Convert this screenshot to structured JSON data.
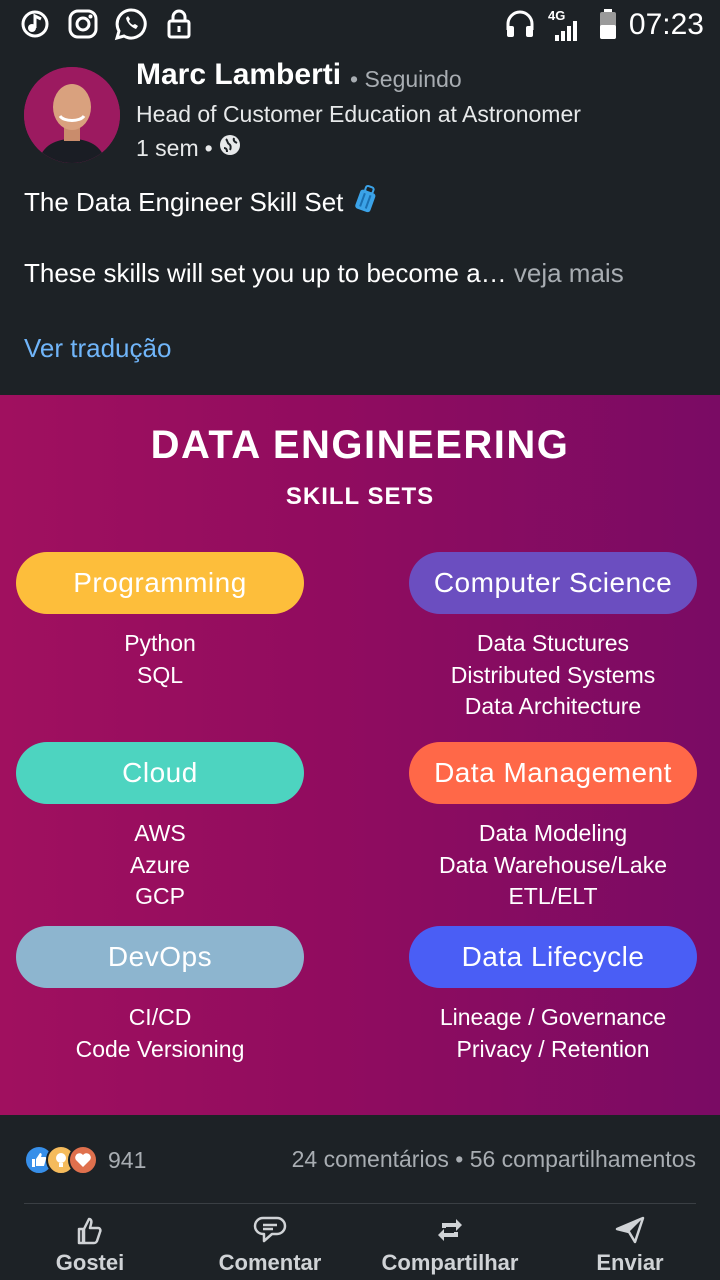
{
  "status_bar": {
    "time": "07:23",
    "network": "4G"
  },
  "post": {
    "author": {
      "name": "Marc Lamberti",
      "follow_state": "Seguindo",
      "headline": "Head of Customer Education at Astronomer",
      "time": "1 sem"
    },
    "title": "The Data Engineer Skill Set",
    "body_preview": "These skills will set you up to become a…",
    "see_more": "veja mais",
    "translate": "Ver tradução"
  },
  "infographic": {
    "title": "DATA ENGINEERING",
    "subtitle": "SKILL SETS",
    "categories": [
      {
        "label": "Programming",
        "color": "#fdbe3b",
        "items": [
          "Python",
          "SQL"
        ]
      },
      {
        "label": "Computer Science",
        "color": "#6b4ec0",
        "items": [
          "Data Stuctures",
          "Distributed Systems",
          "Data Architecture"
        ]
      },
      {
        "label": "Cloud",
        "color": "#4dd4c0",
        "items": [
          "AWS",
          "Azure",
          "GCP"
        ]
      },
      {
        "label": "Data Management",
        "color": "#ff6848",
        "items": [
          "Data Modeling",
          "Data Warehouse/Lake",
          "ETL/ELT"
        ]
      },
      {
        "label": "DevOps",
        "color": "#8db5cf",
        "items": [
          "CI/CD",
          "Code Versioning"
        ]
      },
      {
        "label": "Data Lifecycle",
        "color": "#4a5ef5",
        "items": [
          "Lineage / Governance",
          "Privacy / Retention"
        ]
      }
    ]
  },
  "social": {
    "reaction_count": "941",
    "comments": "24 comentários",
    "shares": "56 compartilhamentos",
    "separator": "•"
  },
  "actions": {
    "like": "Gostei",
    "comment": "Comentar",
    "share": "Compartilhar",
    "send": "Enviar"
  },
  "colors": {
    "background": "#1d2226",
    "link": "#70b5f9",
    "muted": "#a8adb2"
  },
  "icons": [
    "music-app-icon",
    "instagram-icon",
    "whatsapp-icon",
    "lock-icon",
    "headphones-icon",
    "signal-icon",
    "battery-icon",
    "globe-icon",
    "luggage-icon",
    "like-icon",
    "insightful-icon",
    "love-icon",
    "thumbs-up-icon",
    "comment-icon",
    "repost-icon",
    "send-icon"
  ]
}
